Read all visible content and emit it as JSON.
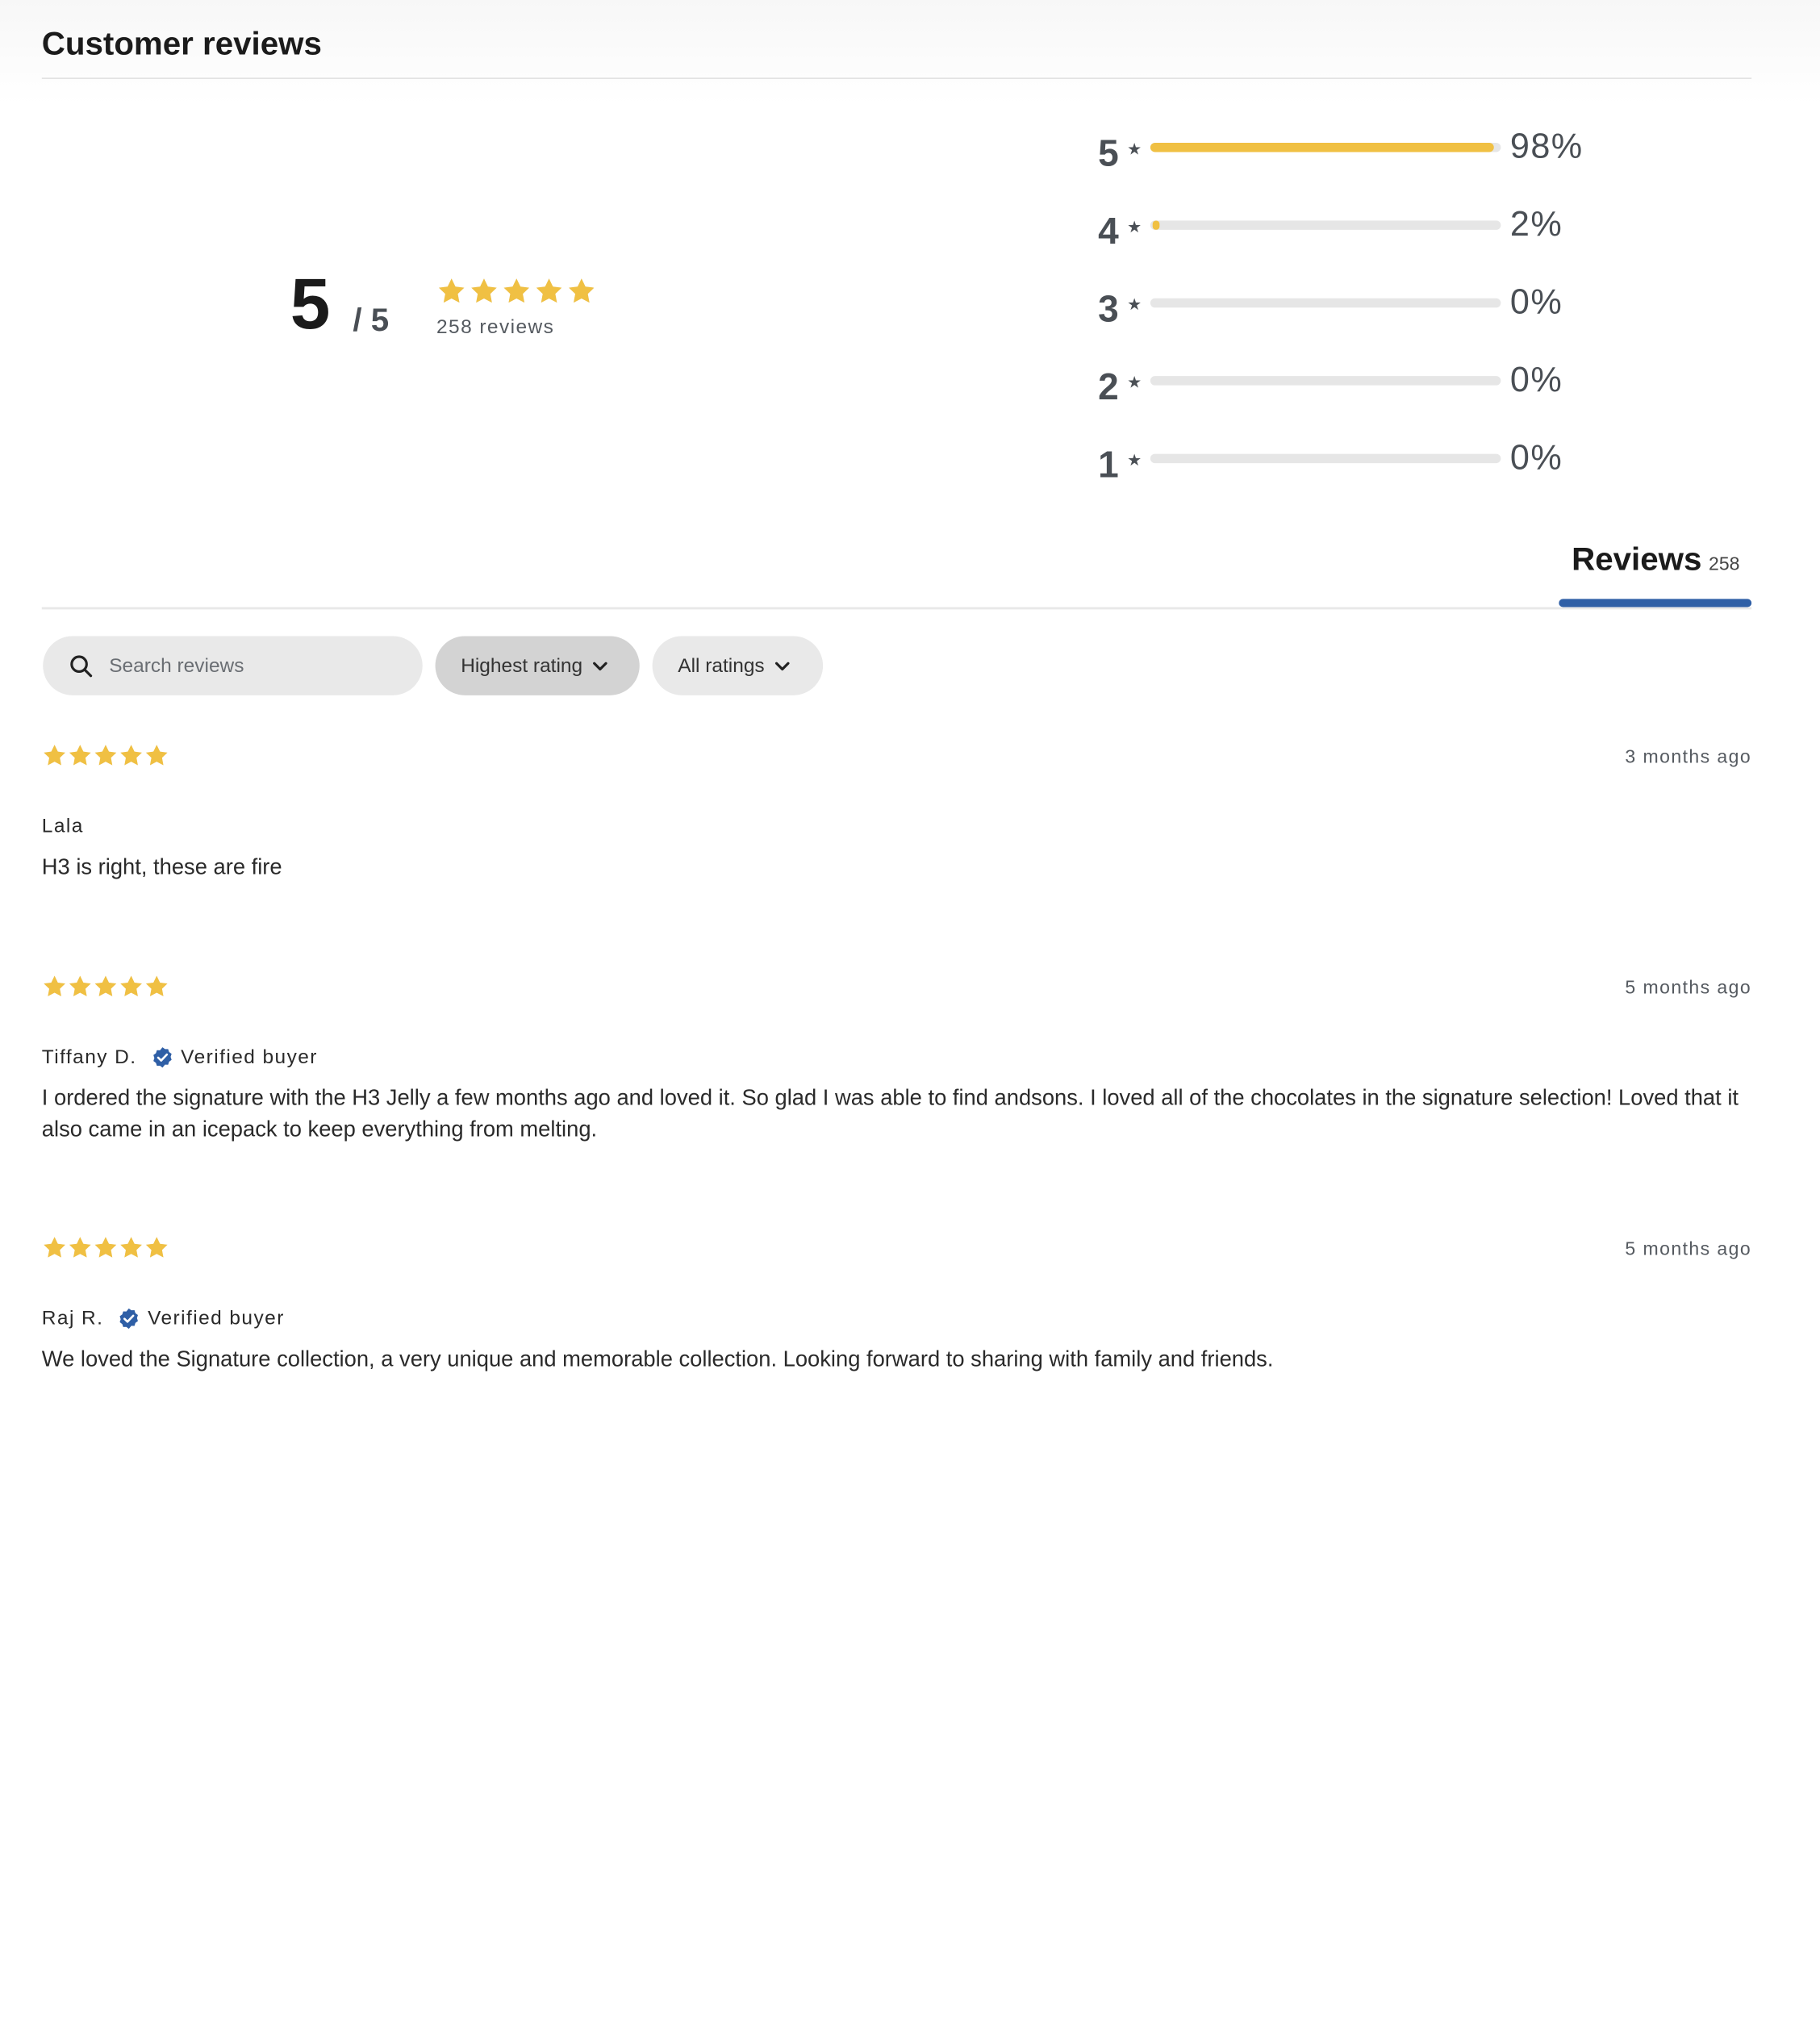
{
  "section": {
    "title": "Customer reviews"
  },
  "summary": {
    "score": "5",
    "out_of": "/ 5",
    "star_rating": 4.9,
    "count_text": "258 reviews"
  },
  "distribution": [
    {
      "stars": "5",
      "percent_text": "98%",
      "fraction": 0.98
    },
    {
      "stars": "4",
      "percent_text": "2%",
      "fraction": 0.02
    },
    {
      "stars": "3",
      "percent_text": "0%",
      "fraction": 0
    },
    {
      "stars": "2",
      "percent_text": "0%",
      "fraction": 0
    },
    {
      "stars": "1",
      "percent_text": "0%",
      "fraction": 0
    }
  ],
  "tabs": {
    "reviews_label": "Reviews",
    "reviews_count": "258"
  },
  "search": {
    "placeholder": "Search reviews"
  },
  "filters": {
    "sort_label": "Highest rating",
    "rating_label": "All ratings"
  },
  "colors": {
    "star": "#f0c043",
    "accent": "#2f5fa6",
    "verified": "#2f5fa6"
  },
  "reviews": [
    {
      "rating": 5,
      "date": "3 months ago",
      "author": "Lala",
      "verified": false,
      "verified_label": "",
      "body": "H3 is right, these are fire"
    },
    {
      "rating": 5,
      "date": "5 months ago",
      "author": "Tiffany D.",
      "verified": true,
      "verified_label": "Verified buyer",
      "body": "I ordered the signature with the H3 Jelly a few months ago and loved it. So glad I was able to find andsons. I loved all of the chocolates in the signature selection! Loved that it also came in an icepack to keep everything from melting."
    },
    {
      "rating": 5,
      "date": "5 months ago",
      "author": "Raj R.",
      "verified": true,
      "verified_label": "Verified buyer",
      "body": "We loved the Signature collection, a very unique and memorable collection. Looking forward to sharing with family and friends."
    }
  ]
}
